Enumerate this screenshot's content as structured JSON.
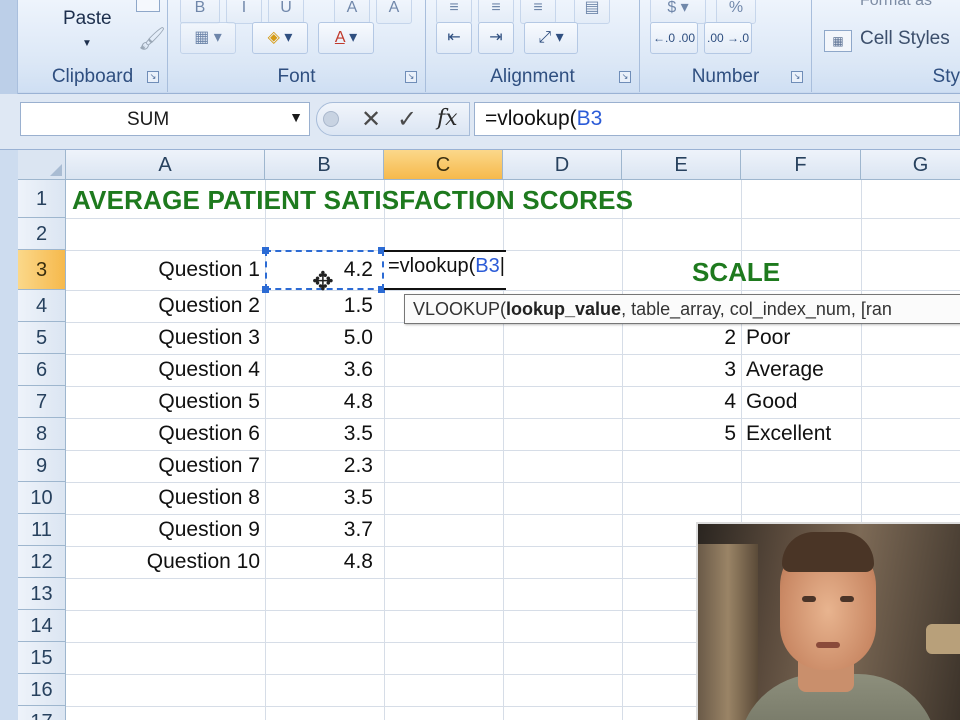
{
  "ribbon": {
    "paste_label": "Paste",
    "groups": {
      "clipboard": "Clipboard",
      "font": "Font",
      "alignment": "Alignment",
      "number": "Number",
      "styles_partial": "Sty"
    },
    "cell_styles_label": "Cell Styles",
    "format_as_partial": "Format as",
    "number_buttons": {
      "increase_decimal": "←.0 .00",
      "decrease_decimal": ".00 →.0"
    }
  },
  "formula_bar": {
    "name_box_value": "SUM",
    "formula_prefix": "=vlookup(",
    "formula_ref": "B3"
  },
  "columns": [
    "A",
    "B",
    "C",
    "D",
    "E",
    "F",
    "G"
  ],
  "active_column": "C",
  "rows": [
    "1",
    "2",
    "3",
    "4",
    "5",
    "6",
    "7",
    "8",
    "9",
    "10",
    "11",
    "12",
    "13",
    "14",
    "15",
    "16",
    "17"
  ],
  "active_row": "3",
  "sheet": {
    "title": "AVERAGE PATIENT SATISFACTION SCORES",
    "questions": [
      {
        "label": "Question 1",
        "score": "4.2"
      },
      {
        "label": "Question 2",
        "score": "1.5"
      },
      {
        "label": "Question 3",
        "score": "5.0"
      },
      {
        "label": "Question 4",
        "score": "3.6"
      },
      {
        "label": "Question 5",
        "score": "4.8"
      },
      {
        "label": "Question 6",
        "score": "3.5"
      },
      {
        "label": "Question 7",
        "score": "2.3"
      },
      {
        "label": "Question 8",
        "score": "3.5"
      },
      {
        "label": "Question 9",
        "score": "3.7"
      },
      {
        "label": "Question 10",
        "score": "4.8"
      }
    ],
    "scale_title": "SCALE",
    "scale": [
      {
        "num": "2",
        "label": "Poor"
      },
      {
        "num": "3",
        "label": "Average"
      },
      {
        "num": "4",
        "label": "Good"
      },
      {
        "num": "5",
        "label": "Excellent"
      }
    ],
    "editing_cell_prefix": "=vlookup(",
    "editing_cell_ref": "B3"
  },
  "tooltip": {
    "func": "VLOOKUP(",
    "arg_bold": "lookup_value",
    "rest": ", table_array, col_index_num, [ran"
  },
  "colors": {
    "title_green": "#1e7a1e",
    "ref_blue": "#2b5bd7",
    "active_header": "#f6b94c"
  }
}
